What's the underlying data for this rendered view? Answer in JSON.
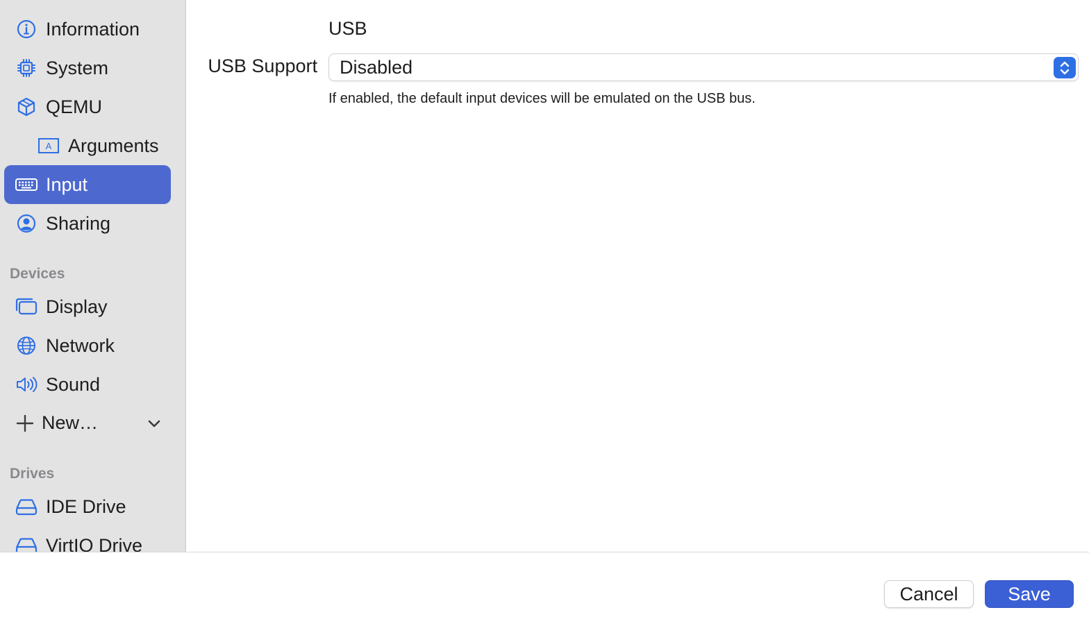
{
  "sidebar": {
    "items": [
      {
        "label": "Information",
        "icon": "info-circle-icon"
      },
      {
        "label": "System",
        "icon": "cpu-chip-icon"
      },
      {
        "label": "QEMU",
        "icon": "cube-icon"
      },
      {
        "label": "Arguments",
        "icon": "text-box-icon"
      },
      {
        "label": "Input",
        "icon": "keyboard-icon",
        "selected": true
      },
      {
        "label": "Sharing",
        "icon": "person-circle-icon"
      }
    ],
    "devices_header": "Devices",
    "devices": [
      {
        "label": "Display",
        "icon": "display-icon"
      },
      {
        "label": "Network",
        "icon": "globe-icon"
      },
      {
        "label": "Sound",
        "icon": "speaker-icon"
      }
    ],
    "new_item": {
      "label": "New…",
      "icon": "plus-icon"
    },
    "drives_header": "Drives",
    "drives": [
      {
        "label": "IDE Drive",
        "icon": "drive-icon"
      },
      {
        "label": "VirtIO Drive",
        "icon": "drive-icon"
      }
    ]
  },
  "main": {
    "section_title": "USB",
    "usb_support": {
      "label": "USB Support",
      "value": "Disabled",
      "help": "If enabled, the default input devices will be emulated on the USB bus."
    }
  },
  "footer": {
    "cancel_label": "Cancel",
    "save_label": "Save"
  },
  "colors": {
    "accent": "#2f6fe4",
    "selection": "#4d69cf",
    "save_button": "#3b5fd4",
    "icon_blue": "#2f6fe4"
  }
}
